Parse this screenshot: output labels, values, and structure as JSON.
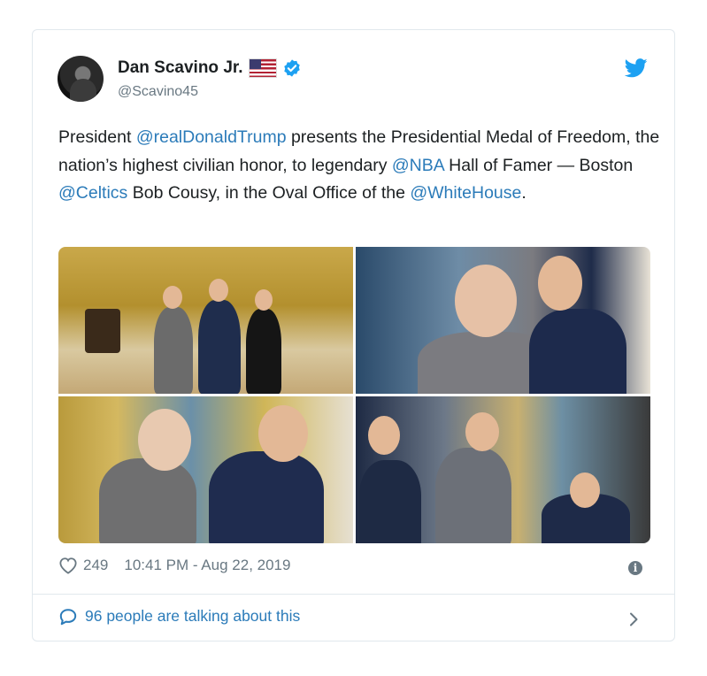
{
  "author": {
    "name": "Dan Scavino Jr.",
    "handle": "@Scavino45",
    "flag_icon": "us-flag-emoji",
    "verified_icon": "verified-badge-icon"
  },
  "tweet": {
    "segments": [
      {
        "text": "President ",
        "mention": false
      },
      {
        "text": "@realDonaldTrump",
        "mention": true
      },
      {
        "text": " presents the Presidential Medal of Freedom, the nation’s highest civilian honor, to legendary ",
        "mention": false
      },
      {
        "text": "@NBA",
        "mention": true
      },
      {
        "text": " Hall of Famer — Boston ",
        "mention": false
      },
      {
        "text": "@Celtics",
        "mention": true
      },
      {
        "text": " Bob Cousy, in the Oval Office of the ",
        "mention": false
      },
      {
        "text": "@WhiteHouse",
        "mention": true
      },
      {
        "text": ".",
        "mention": false
      }
    ]
  },
  "stats": {
    "likes": "249",
    "timestamp": "10:41 PM - Aug 22, 2019"
  },
  "footer": {
    "talking": "96 people are talking about this"
  },
  "colors": {
    "link": "#2b7bb9",
    "text": "#1c2022",
    "muted": "#697882",
    "twitter_blue": "#1da1f2"
  }
}
